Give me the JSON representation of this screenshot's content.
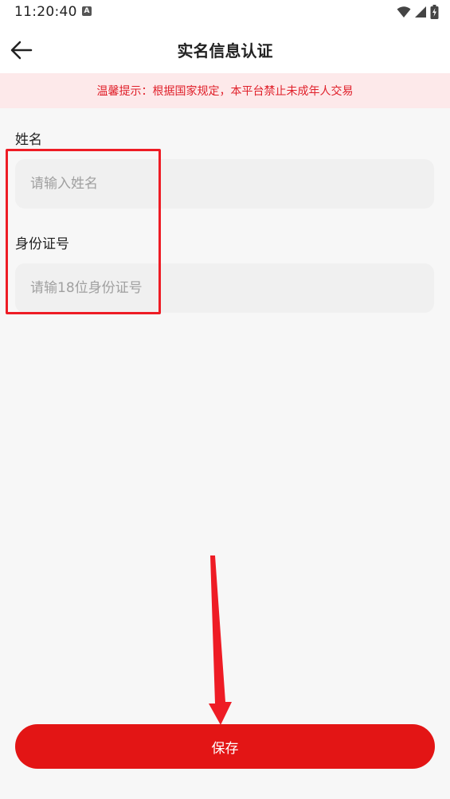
{
  "status_bar": {
    "time": "11:20:40",
    "notification_icon_letter": "A"
  },
  "header": {
    "title": "实名信息认证",
    "back_icon": "arrow-left-icon"
  },
  "notice": {
    "text": "温馨提示：根据国家规定，本平台禁止未成年人交易",
    "color": "#e0202a",
    "background": "#fde9ea"
  },
  "form": {
    "name_label": "姓名",
    "name_placeholder": "请输入姓名",
    "name_value": "",
    "id_label": "身份证号",
    "id_placeholder": "请输18位身份证号",
    "id_value": ""
  },
  "save_button": {
    "label": "保存",
    "color": "#e31515"
  },
  "annotation": {
    "color": "#ee1c25"
  }
}
